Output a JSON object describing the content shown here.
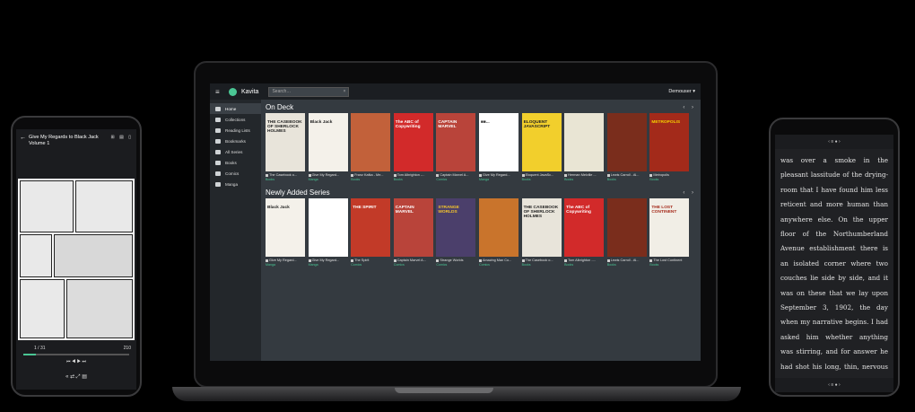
{
  "app": {
    "name": "Kavita",
    "search_placeholder": "Search…",
    "search_clear": "×",
    "user": "Demouser ▾",
    "menu_icon": "≡"
  },
  "sidebar": {
    "items": [
      {
        "label": "Home",
        "icon": "home-icon",
        "active": true
      },
      {
        "label": "Collections",
        "icon": "collections-icon"
      },
      {
        "label": "Reading Lists",
        "icon": "list-icon"
      },
      {
        "label": "Bookmarks",
        "icon": "bookmark-icon"
      },
      {
        "label": "All Series",
        "icon": "grid-icon"
      },
      {
        "label": "Books",
        "icon": "book-icon"
      },
      {
        "label": "Comics",
        "icon": "book-icon"
      },
      {
        "label": "Manga",
        "icon": "book-icon"
      }
    ]
  },
  "on_deck": {
    "title": "On Deck",
    "arrows": "‹ ›",
    "cards": [
      {
        "title": "The Casebook o...",
        "library": "Books",
        "bg": "#e8e4da",
        "fg": "#222",
        "cover": "THE CASEBOOK OF SHERLOCK HOLMES"
      },
      {
        "title": "Give My Regard...",
        "library": "Manga",
        "bg": "#f4f1ea",
        "fg": "#222",
        "cover": "Black Jack"
      },
      {
        "title": "Franz Kafka - Me...",
        "library": "Books",
        "bg": "#c2613a",
        "fg": "#fff",
        "cover": ""
      },
      {
        "title": "Tom Albrighton -...",
        "library": "Books",
        "bg": "#d22a2a",
        "fg": "#fff",
        "cover": "The ABC of Copywriting"
      },
      {
        "title": "Captain Marvel A...",
        "library": "Comics",
        "bg": "#b9443a",
        "fg": "#fff",
        "cover": "CAPTAIN MARVEL"
      },
      {
        "title": "Give My Regard...",
        "library": "Manga",
        "bg": "#ffffff",
        "fg": "#333",
        "cover": "■■..."
      },
      {
        "title": "Eloquent JavaSc...",
        "library": "Books",
        "bg": "#f2cf2c",
        "fg": "#222",
        "cover": "ELOQUENT JAVASCRIPT"
      },
      {
        "title": "Herman Melville ...",
        "library": "Books",
        "bg": "#e9e5d4",
        "fg": "#333",
        "cover": ""
      },
      {
        "title": "Lewis Carroll - Al...",
        "library": "Books",
        "bg": "#7a2d1c",
        "fg": "#f5e6c0",
        "cover": ""
      },
      {
        "title": "Metropolis",
        "library": "Books",
        "bg": "#a32a1a",
        "fg": "#f6d100",
        "cover": "METROPOLIS"
      }
    ]
  },
  "newly_added": {
    "title": "Newly Added Series",
    "arrows": "‹ ›",
    "cards": [
      {
        "title": "Give My Regard...",
        "library": "Manga",
        "bg": "#f4f1ea",
        "fg": "#222",
        "cover": "Black Jack"
      },
      {
        "title": "Give My Regard...",
        "library": "Manga",
        "bg": "#ffffff",
        "fg": "#333",
        "cover": ""
      },
      {
        "title": "The Spirit",
        "library": "Comics",
        "bg": "#c23a28",
        "fg": "#fff",
        "cover": "THE SPIRIT"
      },
      {
        "title": "Captain Marvel A...",
        "library": "Comics",
        "bg": "#b9443a",
        "fg": "#fff",
        "cover": "CAPTAIN MARVEL"
      },
      {
        "title": "Strange Worlds",
        "library": "Comics",
        "bg": "#4b3f6b",
        "fg": "#f4c42c",
        "cover": "STRANGE WORLDS"
      },
      {
        "title": "Amazing Man Co...",
        "library": "Comics",
        "bg": "#c9742c",
        "fg": "#fff",
        "cover": ""
      },
      {
        "title": "The Casebook o...",
        "library": "Books",
        "bg": "#e8e4da",
        "fg": "#222",
        "cover": "THE CASEBOOK OF SHERLOCK HOLMES"
      },
      {
        "title": "Tom Albrighton -...",
        "library": "Books",
        "bg": "#d22a2a",
        "fg": "#fff",
        "cover": "The ABC of Copywriting"
      },
      {
        "title": "Lewis Carroll - Al...",
        "library": "Books",
        "bg": "#7a2d1c",
        "fg": "#f5e6c0",
        "cover": ""
      },
      {
        "title": "The Lost Continent",
        "library": "Books",
        "bg": "#f1eee6",
        "fg": "#a52a1a",
        "cover": "THE LOST CONTINENT"
      }
    ]
  },
  "manga_reader": {
    "back_icon": "←",
    "title": "Give My Regards to Black Jack Volume 1",
    "header_icons": "⊞ ▤ ▯",
    "page_current": "1 / 31",
    "page_total": "210",
    "progress": 0.12,
    "nav_buttons": "⏮ ◀ ▶ ⏭",
    "tool_buttons": "« ⇄ ⤢ ▤"
  },
  "book_reader": {
    "top_icons": "‹ ≡ ● ›",
    "text": "was over a smoke in the pleasant lassitude of the drying-room that I have found him less reticent and more human than anywhere else. On the upper floor of the Northumberland Avenue establishment there is an isolated corner where two couches lie side by side, and it was on these that we lay upon September 3, 1902, the day when my narrative begins. I had asked him whether anything was stirring, and for answer he had shot his long, thin, nervous arm out of the sheets which enveloped him and",
    "bottom_icons": "‹ ≡ ● ›"
  }
}
